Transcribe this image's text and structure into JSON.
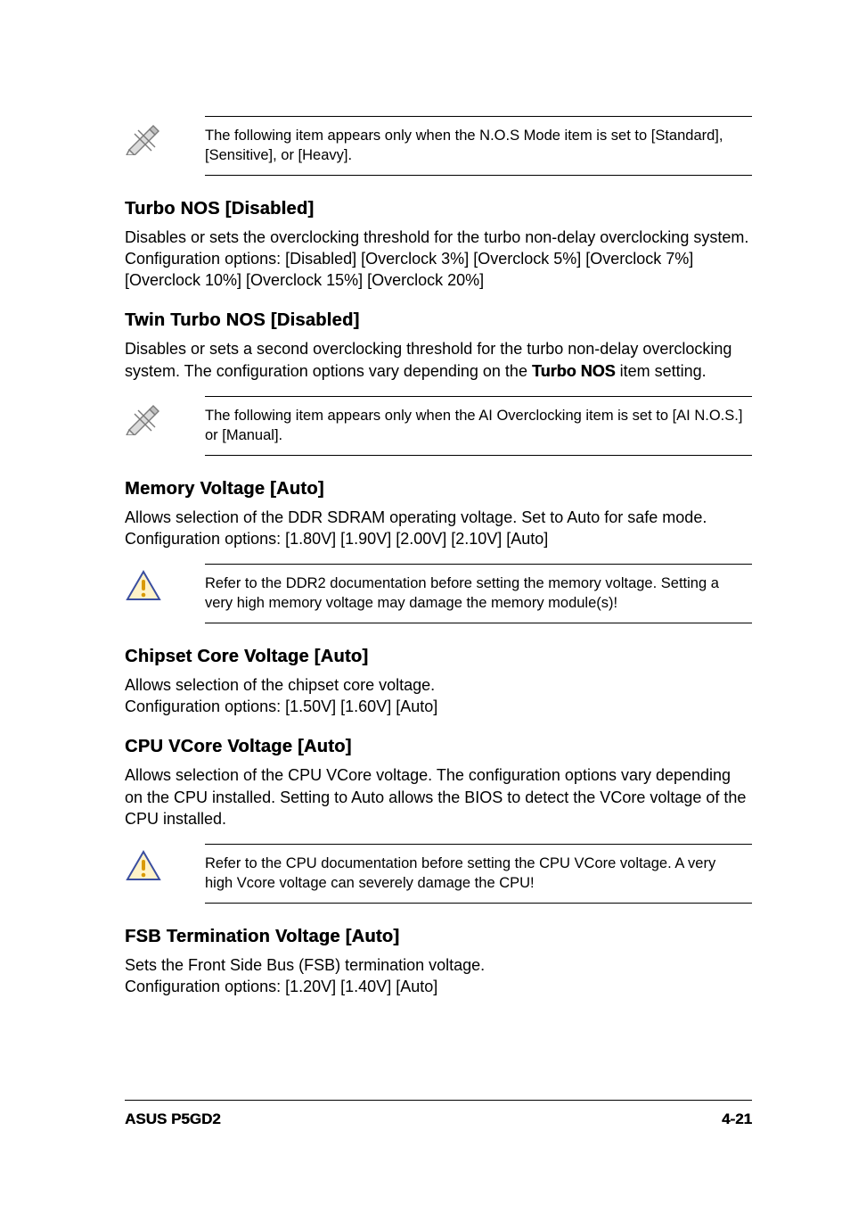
{
  "notes": {
    "note1": "The following item appears only when the N.O.S Mode item is set to [Standard], [Sensitive], or [Heavy].",
    "note2": "The following item appears only when the AI Overclocking item is set to [AI N.O.S.] or [Manual].",
    "warn1": "Refer to the DDR2 documentation before setting the memory voltage. Setting a very high memory voltage may damage the memory module(s)!",
    "warn2": "Refer to the CPU documentation before setting the CPU VCore voltage. A very high Vcore voltage can severely damage the CPU!"
  },
  "sections": {
    "turboNos": {
      "heading": "Turbo NOS [Disabled]",
      "body": "Disables or sets the overclocking threshold for the turbo non-delay overclocking system. Configuration options: [Disabled] [Overclock 3%] [Overclock 5%] [Overclock 7%] [Overclock 10%] [Overclock 15%] [Overclock 20%]"
    },
    "twinTurboNos": {
      "heading": "Twin Turbo NOS [Disabled]",
      "body_pre": "Disables or sets a second overclocking threshold for the turbo non-delay overclocking system. The configuration options vary depending on the ",
      "body_bold": "Turbo NOS",
      "body_post": " item setting."
    },
    "memVoltage": {
      "heading": "Memory Voltage [Auto]",
      "body": "Allows selection of the DDR SDRAM operating voltage. Set to Auto for safe mode. Configuration options: [1.80V] [1.90V] [2.00V] [2.10V] [Auto]"
    },
    "chipsetCore": {
      "heading": "Chipset Core Voltage [Auto]",
      "body": "Allows selection of the chipset core voltage.\nConfiguration options: [1.50V] [1.60V] [Auto]"
    },
    "cpuVcore": {
      "heading": "CPU VCore Voltage [Auto]",
      "body": "Allows selection of the CPU VCore voltage. The configuration options vary depending on the CPU installed. Setting to Auto allows the BIOS to detect the VCore voltage of the CPU installed."
    },
    "fsbTerm": {
      "heading": "FSB Termination Voltage [Auto]",
      "body": "Sets the Front Side Bus (FSB) termination voltage.\nConfiguration options: [1.20V] [1.40V] [Auto]"
    }
  },
  "footer": {
    "left": "ASUS P5GD2",
    "right": "4-21"
  }
}
